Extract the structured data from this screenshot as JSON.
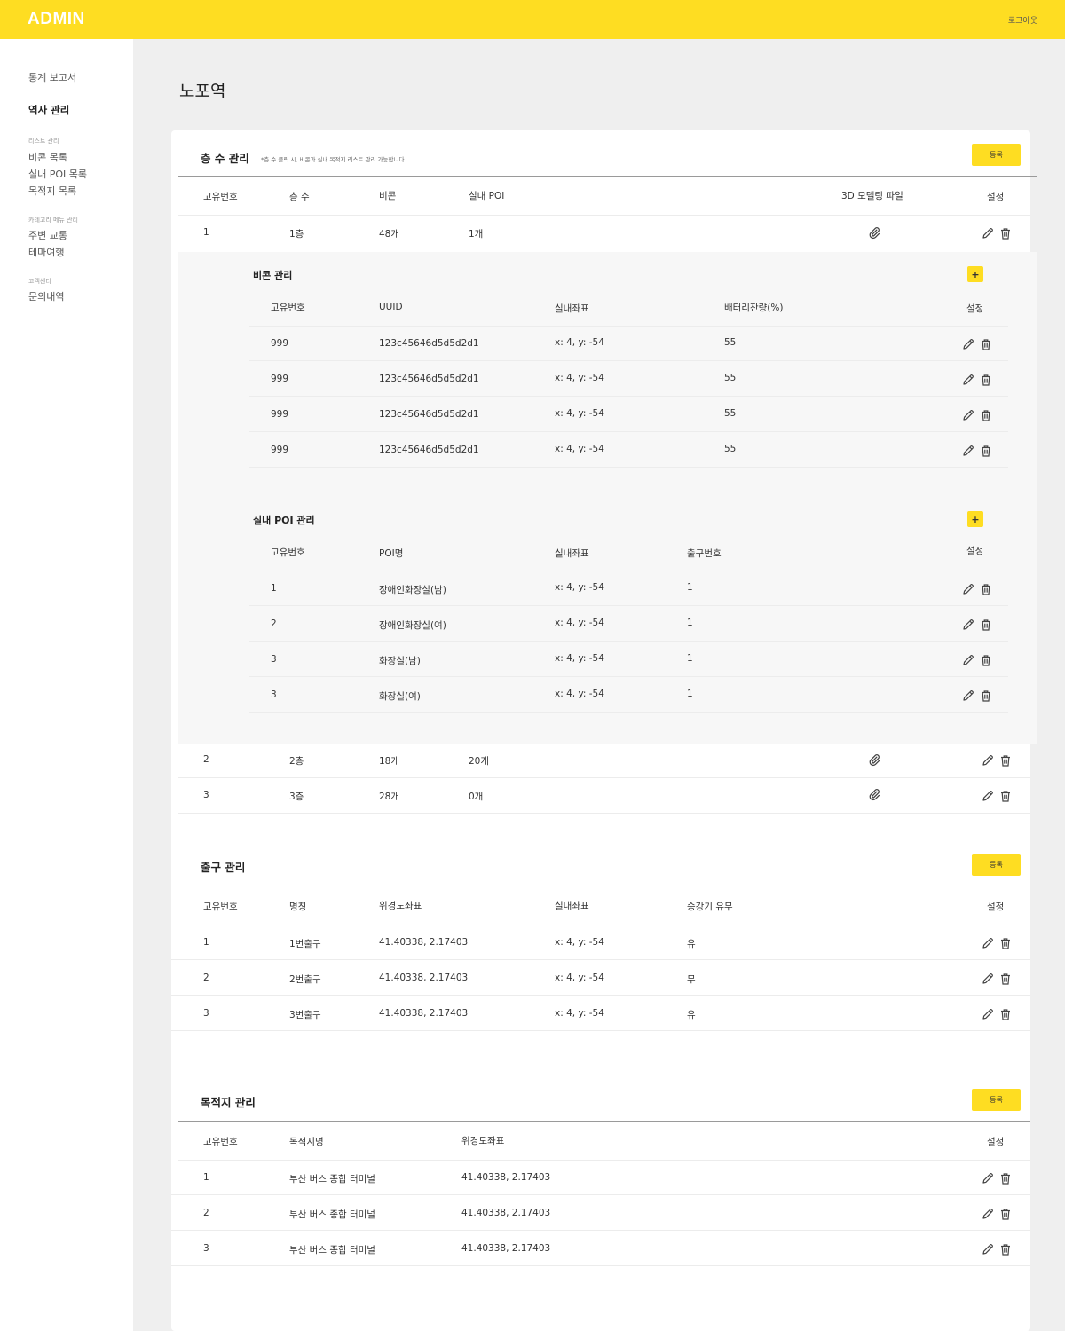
{
  "header": {
    "logo": "ADMIN",
    "logout": "로그아웃"
  },
  "sidebar": {
    "items": [
      {
        "label": "통계 보고서",
        "active": false
      },
      {
        "label": "역사 관리",
        "active": true
      }
    ],
    "groups": [
      {
        "title": "리스트 관리",
        "items": [
          "비콘 목록",
          "실내 POI 목록",
          "목적지 목록"
        ]
      },
      {
        "title": "카테고리 메뉴 관리",
        "items": [
          "주변 교통",
          "테마여행"
        ]
      },
      {
        "title": "고객센터",
        "items": [
          "문의내역"
        ]
      }
    ]
  },
  "page": {
    "title": "노포역"
  },
  "floors": {
    "title": "층 수 관리",
    "note": "*층 수 클릭 시, 비콘과 실내 목적지 리스트 관리 가능합니다.",
    "register_label": "등록",
    "columns": [
      "고유번호",
      "층 수",
      "비콘",
      "실내 POI",
      "3D 모델링 파일",
      "설정"
    ],
    "rows": [
      {
        "id": "1",
        "floor": "1층",
        "beacon": "48개",
        "poi": "1개"
      },
      {
        "id": "2",
        "floor": "2층",
        "beacon": "18개",
        "poi": "20개"
      },
      {
        "id": "3",
        "floor": "3층",
        "beacon": "28개",
        "poi": "0개"
      }
    ],
    "beacons": {
      "title": "비콘 관리",
      "add_label": "+",
      "columns": [
        "고유번호",
        "UUID",
        "실내좌표",
        "배터리잔량(%)",
        "설정"
      ],
      "rows": [
        {
          "id": "999",
          "uuid": "123c45646d5d5d2d1",
          "coord": "x: 4, y: -54",
          "battery": "55"
        },
        {
          "id": "999",
          "uuid": "123c45646d5d5d2d1",
          "coord": "x: 4, y: -54",
          "battery": "55"
        },
        {
          "id": "999",
          "uuid": "123c45646d5d5d2d1",
          "coord": "x: 4, y: -54",
          "battery": "55"
        },
        {
          "id": "999",
          "uuid": "123c45646d5d5d2d1",
          "coord": "x: 4, y: -54",
          "battery": "55"
        }
      ]
    },
    "pois": {
      "title": "실내 POI 관리",
      "add_label": "+",
      "columns": [
        "고유번호",
        "POI명",
        "실내좌표",
        "출구번호",
        "설정"
      ],
      "rows": [
        {
          "id": "1",
          "name": "장애인화장실(남)",
          "coord": "x: 4, y: -54",
          "exit": "1"
        },
        {
          "id": "2",
          "name": "장애인화장실(여)",
          "coord": "x: 4, y: -54",
          "exit": "1"
        },
        {
          "id": "3",
          "name": "화장실(남)",
          "coord": "x: 4, y: -54",
          "exit": "1"
        },
        {
          "id": "3",
          "name": "화장실(여)",
          "coord": "x: 4, y: -54",
          "exit": "1"
        }
      ]
    }
  },
  "exits": {
    "title": "출구 관리",
    "register_label": "등록",
    "columns": [
      "고유번호",
      "명칭",
      "위경도좌표",
      "실내좌표",
      "승강기 유무",
      "설정"
    ],
    "rows": [
      {
        "id": "1",
        "name": "1번출구",
        "latlng": "41.40338, 2.17403",
        "coord": "x: 4, y: -54",
        "elevator": "유"
      },
      {
        "id": "2",
        "name": "2번출구",
        "latlng": "41.40338, 2.17403",
        "coord": "x: 4, y: -54",
        "elevator": "무"
      },
      {
        "id": "3",
        "name": "3번출구",
        "latlng": "41.40338, 2.17403",
        "coord": "x: 4, y: -54",
        "elevator": "유"
      }
    ]
  },
  "destinations": {
    "title": "목적지 관리",
    "register_label": "등록",
    "columns": [
      "고유번호",
      "목적지명",
      "위경도좌표",
      "설정"
    ],
    "rows": [
      {
        "id": "1",
        "name": "부산 버스 종합 터미널",
        "latlng": "41.40338, 2.17403"
      },
      {
        "id": "2",
        "name": "부산 버스 종합 터미널",
        "latlng": "41.40338, 2.17403"
      },
      {
        "id": "3",
        "name": "부산 버스 종합 터미널",
        "latlng": "41.40338, 2.17403"
      }
    ]
  },
  "colors": {
    "accent": "#fedd22",
    "background": "#efefef",
    "panel": "#ffffff",
    "sub_panel": "#f7f7f7"
  },
  "icons": {
    "edit": "pencil-icon",
    "delete": "trash-icon",
    "file": "paperclip-icon"
  }
}
